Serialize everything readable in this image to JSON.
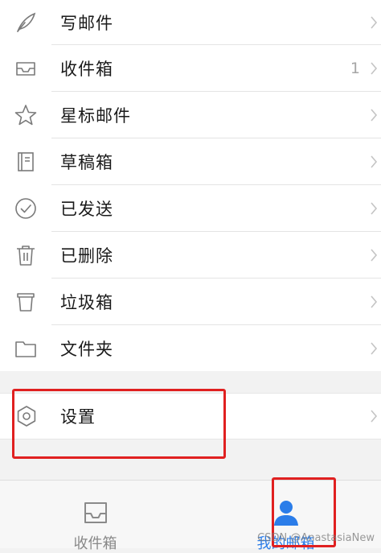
{
  "menu": {
    "items": [
      {
        "label": "写邮件",
        "icon": "feather-icon",
        "count": ""
      },
      {
        "label": "收件箱",
        "icon": "inbox-tray-icon",
        "count": "1"
      },
      {
        "label": "星标邮件",
        "icon": "star-icon",
        "count": ""
      },
      {
        "label": "草稿箱",
        "icon": "draft-note-icon",
        "count": ""
      },
      {
        "label": "已发送",
        "icon": "check-circle-icon",
        "count": ""
      },
      {
        "label": "已删除",
        "icon": "trash-icon",
        "count": ""
      },
      {
        "label": "垃圾箱",
        "icon": "bin-icon",
        "count": ""
      },
      {
        "label": "文件夹",
        "icon": "folder-icon",
        "count": ""
      }
    ]
  },
  "settings": {
    "label": "设置",
    "icon": "hexagon-gear-icon"
  },
  "tabbar": {
    "tabs": [
      {
        "label": "收件箱",
        "icon": "inbox-tray-icon",
        "active": false
      },
      {
        "label": "我的邮箱",
        "icon": "user-icon",
        "active": true
      }
    ]
  },
  "watermark": "CSDN @AnastasiaNew",
  "colors": {
    "highlight": "#e02020",
    "accent": "#2b7de9",
    "icon_gray": "#7a7a7a"
  }
}
